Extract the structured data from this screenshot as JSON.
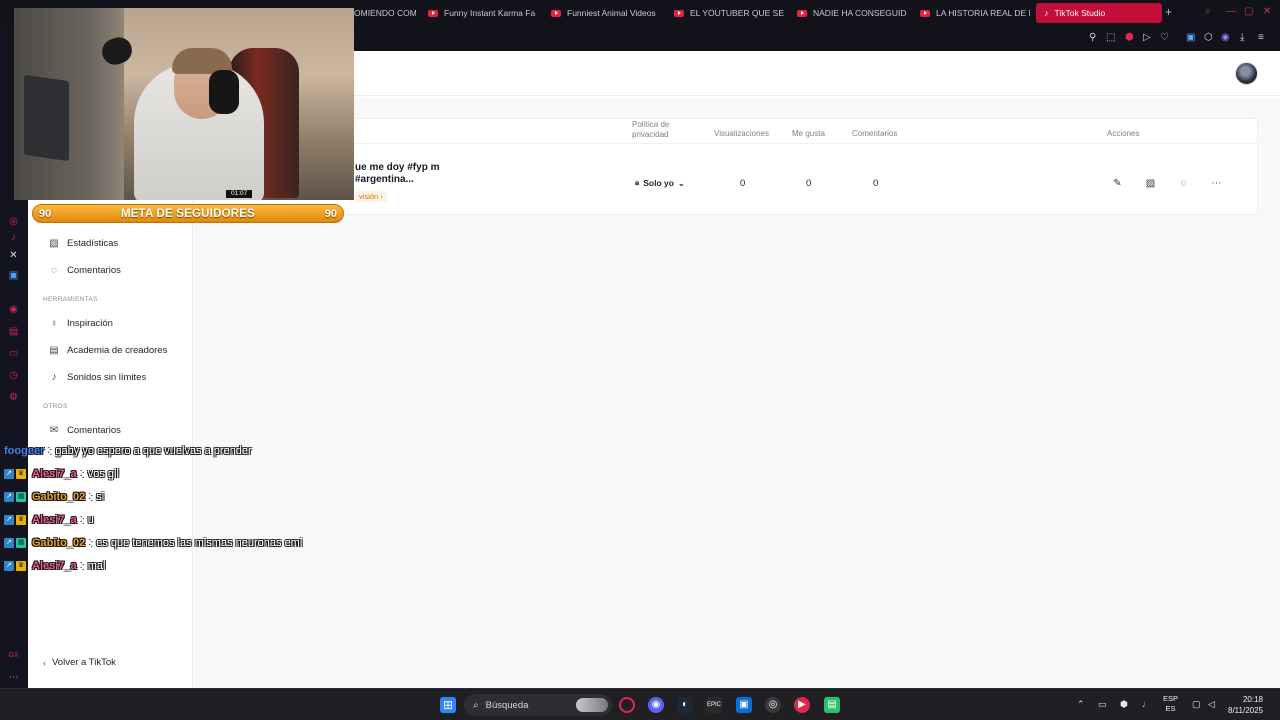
{
  "browser": {
    "tabs": [
      {
        "label": "OMIENDO COM"
      },
      {
        "label": "Funny Instant Karma Fa"
      },
      {
        "label": "Funniest Animal Videos"
      },
      {
        "label": "EL YOUTUBER QUE SE"
      },
      {
        "label": "NADIE HA CONSEGUIDO"
      },
      {
        "label": "LA HISTORIA REAL DE E"
      },
      {
        "label": "TikTok Studio"
      }
    ],
    "new_tab_symbol": "+"
  },
  "stream_overlay": {
    "cam_timer": "01:07",
    "follow_goal": {
      "current": "90",
      "label": "META DE SEGUIDORES",
      "target": "90"
    },
    "chat": [
      {
        "user": "foogeer",
        "color": "#3b7ff0",
        "badges": [],
        "text": "gaby yo espero a que vuelvas a prender"
      },
      {
        "user": "Alesi7_a",
        "color": "#f05a8a",
        "badges": [
          "blue",
          "gold"
        ],
        "text": "vos gil"
      },
      {
        "user": "Gabito_02",
        "color": "#e7a020",
        "badges": [
          "blue",
          "green"
        ],
        "text": "si"
      },
      {
        "user": "Alesi7_a",
        "color": "#f05a8a",
        "badges": [
          "blue",
          "gold"
        ],
        "text": "u"
      },
      {
        "user": "Gabito_02",
        "color": "#e7a020",
        "badges": [
          "blue",
          "green"
        ],
        "text": "es que tenemos las mismas neuronas emi"
      },
      {
        "user": "Alesi7_a",
        "color": "#f05a8a",
        "badges": [
          "blue",
          "gold"
        ],
        "text": "mal"
      }
    ]
  },
  "sidebar": {
    "items_top": [
      {
        "label": "Estadísticas",
        "icon": "chart-icon"
      },
      {
        "label": "Comentarios",
        "icon": "comment-icon"
      }
    ],
    "section_tools": "HERRAMIENTAS",
    "items_tools": [
      {
        "label": "Inspiración",
        "icon": "lightbulb-icon"
      },
      {
        "label": "Academia de creadores",
        "icon": "book-icon"
      },
      {
        "label": "Sonidos sin límites",
        "icon": "music-note-icon"
      }
    ],
    "section_other": "OTROS",
    "items_other": [
      {
        "label": "Comentarios",
        "icon": "mail-icon"
      }
    ],
    "back_link": "Volver a TikTok"
  },
  "table": {
    "headers": {
      "privacy": "Política de privacidad",
      "views": "Visualizaciones",
      "likes": "Me gusta",
      "comments": "Comentarios",
      "actions": "Acciones"
    },
    "row": {
      "title": "ue me doy #fyp m #argentina...",
      "review": "visión ›",
      "privacy": "Solo yo",
      "views": "0",
      "likes": "0",
      "comments": "0"
    }
  },
  "taskbar": {
    "search_placeholder": "Búsqueda",
    "lang_top": "ESP",
    "lang_bottom": "ES",
    "time": "20:18",
    "date": "8/11/2025"
  },
  "colors": {
    "accent_tab": "#c40e3a",
    "follow_bar": "#f0a024",
    "review_orange": "#d4740b"
  }
}
